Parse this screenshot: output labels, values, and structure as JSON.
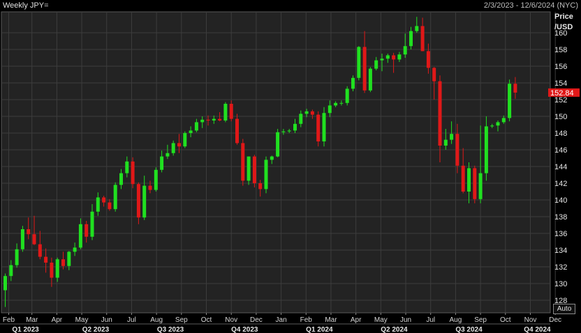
{
  "header": {
    "title": "Weekly JPY=",
    "date_range": "2/3/2023 - 12/6/2024 (NYC)"
  },
  "axis": {
    "y_label_line1": "Price",
    "y_label_line2": "/USD",
    "auto_button": "Auto"
  },
  "colors": {
    "background": "#232323",
    "grid": "#3d3d3d",
    "up": "#20e020",
    "down": "#e01818",
    "last_price_badge": "#e01818"
  },
  "chart_data": {
    "type": "candlestick",
    "title": "Weekly JPY=",
    "ylabel": "Price /USD",
    "ylim": [
      126.5,
      162.5
    ],
    "yticks": [
      128,
      130,
      132,
      134,
      136,
      138,
      140,
      142,
      144,
      146,
      148,
      150,
      152,
      154,
      156,
      158,
      160
    ],
    "last_price": "152.84",
    "months": [
      {
        "label": "Feb",
        "week": 0.6
      },
      {
        "label": "Mar",
        "week": 4.6
      },
      {
        "label": "Apr",
        "week": 8.9
      },
      {
        "label": "May",
        "week": 13.2
      },
      {
        "label": "Jun",
        "week": 17.5
      },
      {
        "label": "Jul",
        "week": 21.8
      },
      {
        "label": "Aug",
        "week": 26.1
      },
      {
        "label": "Sep",
        "week": 30.4
      },
      {
        "label": "Oct",
        "week": 34.7
      },
      {
        "label": "Nov",
        "week": 39.0
      },
      {
        "label": "Dec",
        "week": 43.3
      },
      {
        "label": "Jan",
        "week": 47.6
      },
      {
        "label": "Feb",
        "week": 51.9
      },
      {
        "label": "Mar",
        "week": 56.2
      },
      {
        "label": "Apr",
        "week": 60.5
      },
      {
        "label": "May",
        "week": 64.8
      },
      {
        "label": "Jun",
        "week": 69.1
      },
      {
        "label": "Jul",
        "week": 73.4
      },
      {
        "label": "Aug",
        "week": 77.7
      },
      {
        "label": "Sep",
        "week": 82.0
      },
      {
        "label": "Oct",
        "week": 86.3
      },
      {
        "label": "Nov",
        "week": 90.6
      },
      {
        "label": "Dec",
        "week": 94.9
      }
    ],
    "quarters": [
      {
        "label": "Q1 2023",
        "week": 3.5
      },
      {
        "label": "Q2 2023",
        "week": 15.6
      },
      {
        "label": "Q3 2023",
        "week": 28.5
      },
      {
        "label": "Q4 2023",
        "week": 41.3
      },
      {
        "label": "Q1 2024",
        "week": 54.2
      },
      {
        "label": "Q2 2024",
        "week": 67.1
      },
      {
        "label": "Q3 2024",
        "week": 80.0
      },
      {
        "label": "Q4 2024",
        "week": 91.8
      }
    ],
    "candles": [
      [
        129.2,
        131.2,
        127.2,
        130.9
      ],
      [
        130.9,
        132.8,
        130.3,
        132.2
      ],
      [
        132.2,
        134.8,
        131.9,
        134.1
      ],
      [
        134.1,
        136.9,
        133.8,
        136.5
      ],
      [
        136.5,
        137.9,
        135.3,
        135.9
      ],
      [
        135.9,
        138.1,
        134.6,
        134.7
      ],
      [
        134.7,
        136.3,
        132.9,
        133.2
      ],
      [
        133.2,
        134.2,
        131.3,
        132.5
      ],
      [
        132.5,
        133.1,
        129.6,
        130.7
      ],
      [
        130.7,
        133.1,
        130.2,
        132.9
      ],
      [
        132.9,
        133.8,
        131.7,
        132.1
      ],
      [
        132.1,
        133.9,
        131.6,
        133.8
      ],
      [
        133.8,
        134.9,
        133.3,
        134.3
      ],
      [
        134.3,
        137.8,
        134.1,
        137.1
      ],
      [
        137.1,
        137.5,
        134.9,
        135.6
      ],
      [
        135.6,
        139.5,
        135.2,
        138.6
      ],
      [
        138.6,
        140.9,
        138.1,
        140.3
      ],
      [
        140.3,
        140.5,
        139.2,
        139.7
      ],
      [
        139.7,
        140.1,
        138.7,
        138.9
      ],
      [
        138.9,
        142.1,
        138.6,
        141.8
      ],
      [
        141.8,
        143.7,
        141.3,
        143.2
      ],
      [
        143.2,
        145.2,
        142.7,
        144.6
      ],
      [
        144.6,
        145.1,
        141.4,
        141.9
      ],
      [
        141.9,
        142.1,
        137.1,
        137.9
      ],
      [
        137.9,
        142.9,
        137.6,
        141.7
      ],
      [
        141.7,
        142.3,
        140.8,
        141.2
      ],
      [
        141.2,
        143.9,
        141.0,
        143.6
      ],
      [
        143.6,
        145.9,
        143.3,
        145.2
      ],
      [
        145.2,
        146.6,
        144.9,
        145.6
      ],
      [
        145.6,
        147.1,
        145.3,
        146.8
      ],
      [
        146.8,
        147.9,
        145.6,
        146.4
      ],
      [
        146.4,
        148.2,
        146.2,
        148.0
      ],
      [
        148.0,
        148.8,
        147.5,
        148.3
      ],
      [
        148.3,
        149.7,
        148.1,
        149.3
      ],
      [
        149.3,
        150.0,
        148.6,
        149.6
      ],
      [
        149.6,
        150.1,
        148.9,
        149.5
      ],
      [
        149.5,
        150.1,
        149.1,
        149.7
      ],
      [
        149.7,
        150.5,
        149.4,
        149.5
      ],
      [
        149.5,
        151.7,
        149.3,
        151.5
      ],
      [
        151.5,
        151.9,
        149.4,
        149.7
      ],
      [
        149.7,
        150.3,
        146.6,
        146.8
      ],
      [
        146.8,
        147.3,
        141.7,
        142.3
      ],
      [
        142.3,
        145.2,
        141.8,
        145.2
      ],
      [
        145.2,
        145.4,
        141.5,
        142.0
      ],
      [
        142.0,
        142.4,
        140.4,
        141.3
      ],
      [
        141.3,
        145.2,
        140.8,
        144.8
      ],
      [
        144.8,
        145.3,
        144.3,
        145.2
      ],
      [
        145.2,
        148.5,
        145.1,
        148.1
      ],
      [
        148.1,
        148.5,
        147.8,
        148.2
      ],
      [
        148.2,
        148.5,
        148.0,
        148.3
      ],
      [
        148.3,
        149.7,
        148.0,
        149.1
      ],
      [
        149.1,
        150.7,
        148.7,
        150.3
      ],
      [
        150.3,
        150.9,
        149.9,
        150.6
      ],
      [
        150.6,
        150.8,
        149.7,
        150.2
      ],
      [
        150.2,
        150.6,
        146.4,
        147.0
      ],
      [
        147.0,
        151.1,
        146.4,
        150.4
      ],
      [
        150.4,
        151.9,
        149.9,
        151.3
      ],
      [
        151.3,
        151.8,
        151.1,
        151.6
      ],
      [
        151.6,
        151.9,
        151.3,
        151.6
      ],
      [
        151.6,
        153.6,
        151.3,
        153.3
      ],
      [
        153.3,
        154.9,
        153.0,
        154.6
      ],
      [
        154.6,
        158.4,
        154.3,
        158.3
      ],
      [
        158.3,
        160.2,
        152.8,
        153.1
      ],
      [
        153.1,
        155.9,
        152.9,
        155.7
      ],
      [
        155.7,
        157.1,
        155.5,
        156.7
      ],
      [
        156.7,
        157.5,
        155.4,
        156.9
      ],
      [
        156.9,
        157.5,
        156.4,
        157.3
      ],
      [
        157.3,
        157.6,
        155.2,
        156.8
      ],
      [
        156.8,
        157.7,
        156.5,
        157.4
      ],
      [
        157.4,
        159.9,
        157.0,
        158.4
      ],
      [
        158.4,
        160.7,
        158.0,
        160.2
      ],
      [
        160.2,
        161.9,
        160.0,
        160.8
      ],
      [
        160.8,
        161.8,
        157.8,
        157.8
      ],
      [
        157.8,
        158.7,
        155.1,
        155.8
      ],
      [
        155.8,
        155.9,
        152.0,
        154.2
      ],
      [
        154.2,
        154.9,
        144.5,
        146.5
      ],
      [
        146.5,
        148.5,
        146.0,
        147.2
      ],
      [
        147.2,
        149.4,
        146.7,
        147.9
      ],
      [
        147.9,
        149.1,
        143.2,
        144.1
      ],
      [
        144.1,
        146.2,
        140.8,
        141.0
      ],
      [
        141.0,
        144.5,
        139.6,
        143.8
      ],
      [
        143.8,
        144.1,
        139.6,
        140.1
      ],
      [
        140.1,
        148.9,
        139.6,
        143.2
      ],
      [
        143.2,
        150.0,
        142.3,
        148.8
      ],
      [
        148.8,
        149.1,
        148.6,
        148.9
      ],
      [
        148.9,
        149.5,
        148.2,
        149.3
      ],
      [
        149.3,
        150.1,
        149.1,
        149.8
      ],
      [
        149.8,
        154.4,
        149.4,
        153.9
      ],
      [
        153.9,
        154.7,
        152.1,
        152.84
      ]
    ]
  }
}
